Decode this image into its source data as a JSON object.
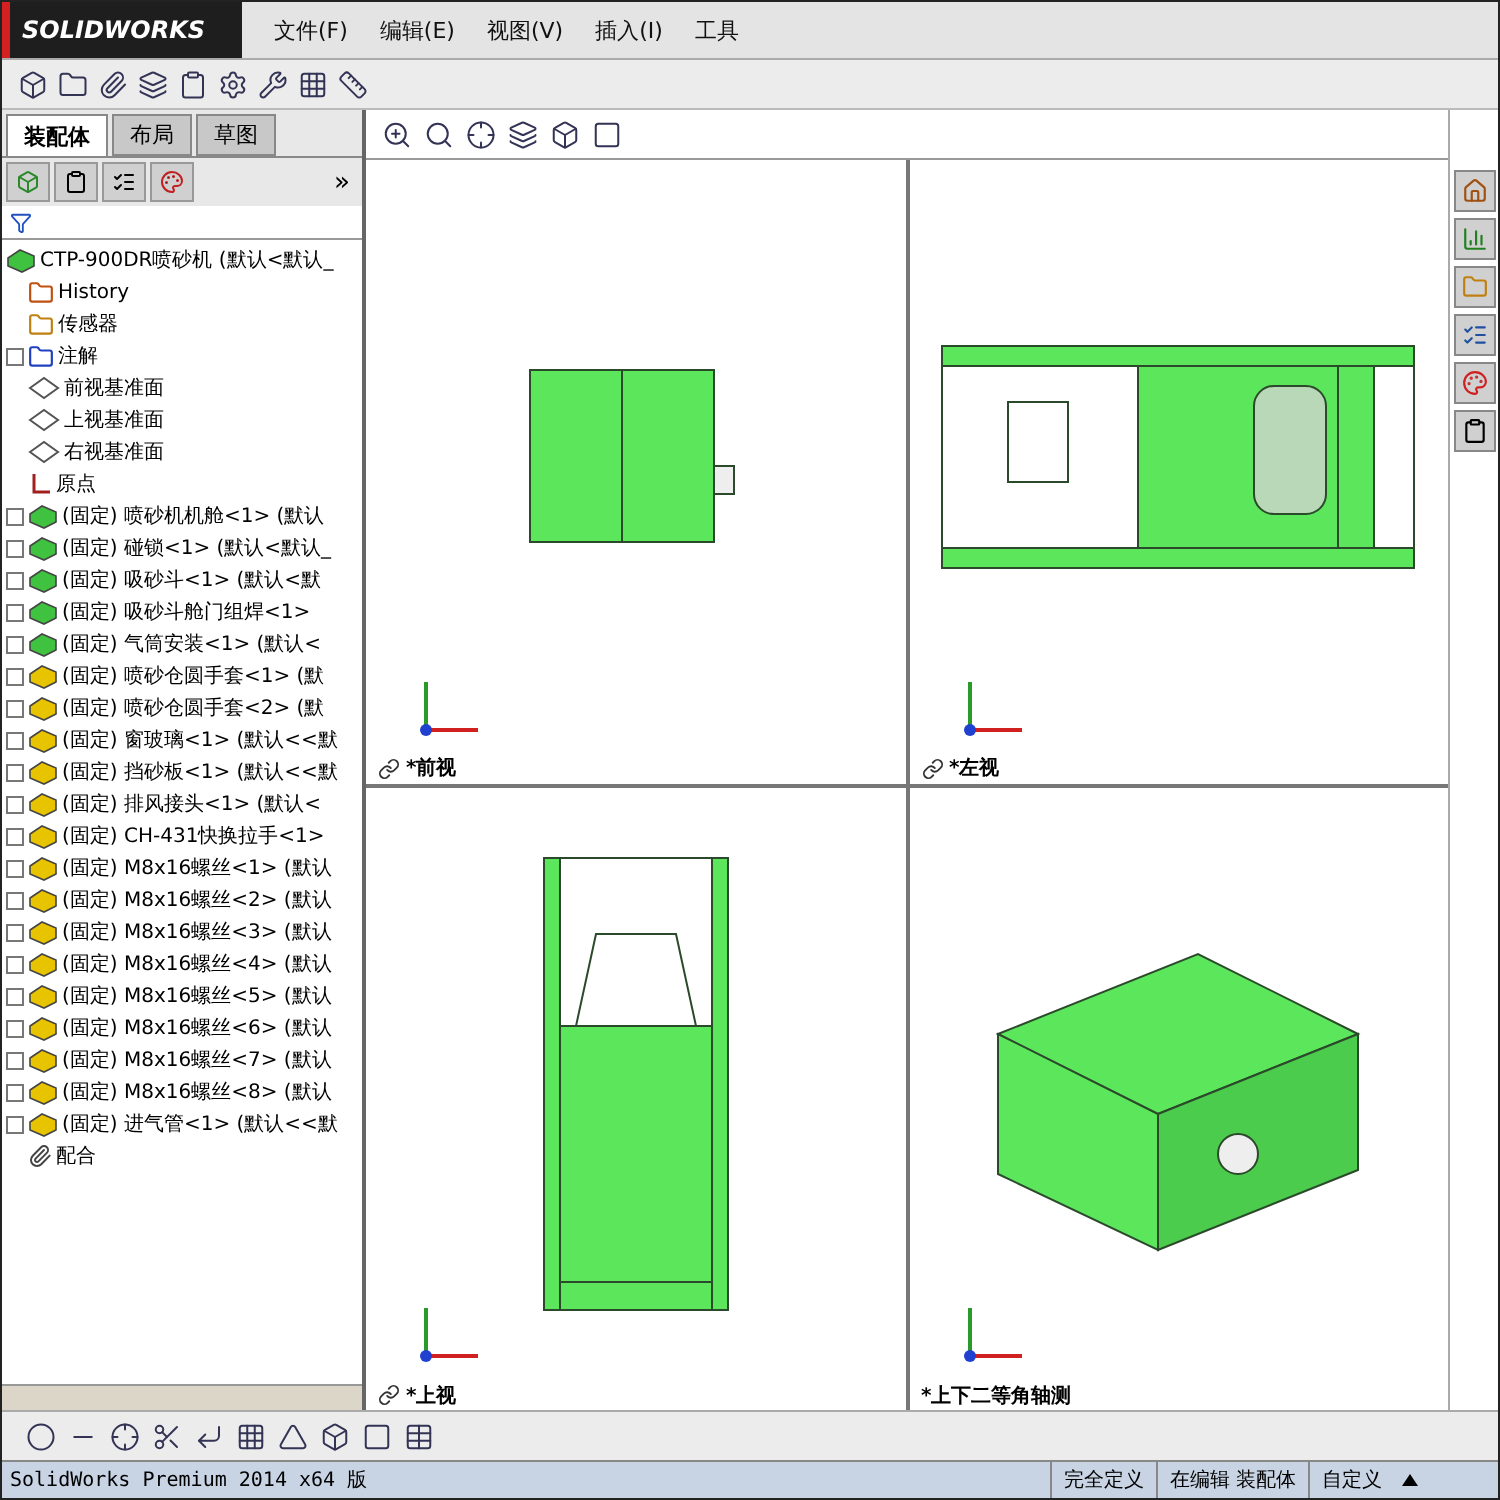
{
  "app": {
    "logo": "SOLIDWORKS",
    "menu": [
      "文件(F)",
      "编辑(E)",
      "视图(V)",
      "插入(I)",
      "工具"
    ]
  },
  "panel": {
    "tabs": [
      {
        "label": "装配体",
        "selected": true
      },
      {
        "label": "布局",
        "selected": false
      },
      {
        "label": "草图",
        "selected": false
      }
    ],
    "more": "»",
    "tree": {
      "label": "CTP-900DR喷砂机  (默认<默认_",
      "children": [
        {
          "kind": "history",
          "label": "History"
        },
        {
          "kind": "sensor",
          "label": "传感器"
        },
        {
          "kind": "annotation",
          "label": "注解",
          "expanded": false
        },
        {
          "kind": "plane",
          "label": "前视基准面"
        },
        {
          "kind": "plane",
          "label": "上视基准面"
        },
        {
          "kind": "plane",
          "label": "右视基准面"
        },
        {
          "kind": "origin",
          "label": "原点"
        },
        {
          "kind": "part",
          "label": "(固定) 喷砂机机舱<1> (默认",
          "expanded": false,
          "color": "#3fc23f"
        },
        {
          "kind": "part",
          "label": "(固定) 碰锁<1> (默认<默认_",
          "expanded": false,
          "color": "#3fc23f"
        },
        {
          "kind": "part",
          "label": "(固定) 吸砂斗<1> (默认<默",
          "expanded": false,
          "color": "#3fc23f"
        },
        {
          "kind": "part",
          "label": "(固定) 吸砂斗舱门组焊<1>",
          "expanded": false,
          "color": "#3fc23f"
        },
        {
          "kind": "part",
          "label": "(固定) 气筒安装<1> (默认<",
          "expanded": false,
          "color": "#3fc23f"
        },
        {
          "kind": "part",
          "label": "(固定) 喷砂仓圆手套<1> (默",
          "expanded": false,
          "color": "#e8c400"
        },
        {
          "kind": "part",
          "label": "(固定) 喷砂仓圆手套<2> (默",
          "expanded": false,
          "color": "#e8c400"
        },
        {
          "kind": "part",
          "label": "(固定) 窗玻璃<1> (默认<<默",
          "expanded": false,
          "color": "#e8c400"
        },
        {
          "kind": "part",
          "label": "(固定) 挡砂板<1> (默认<<默",
          "expanded": false,
          "color": "#e8c400"
        },
        {
          "kind": "part",
          "label": "(固定) 排风接头<1> (默认<",
          "expanded": false,
          "color": "#e8c400"
        },
        {
          "kind": "part",
          "label": "(固定) CH-431快换拉手<1>",
          "expanded": false,
          "color": "#e8c400"
        },
        {
          "kind": "part",
          "label": "(固定) M8x16螺丝<1> (默认",
          "expanded": false,
          "color": "#e8c400"
        },
        {
          "kind": "part",
          "label": "(固定) M8x16螺丝<2> (默认",
          "expanded": false,
          "color": "#e8c400"
        },
        {
          "kind": "part",
          "label": "(固定) M8x16螺丝<3> (默认",
          "expanded": false,
          "color": "#e8c400"
        },
        {
          "kind": "part",
          "label": "(固定) M8x16螺丝<4> (默认",
          "expanded": false,
          "color": "#e8c400"
        },
        {
          "kind": "part",
          "label": "(固定) M8x16螺丝<5> (默认",
          "expanded": false,
          "color": "#e8c400"
        },
        {
          "kind": "part",
          "label": "(固定) M8x16螺丝<6> (默认",
          "expanded": false,
          "color": "#e8c400"
        },
        {
          "kind": "part",
          "label": "(固定) M8x16螺丝<7> (默认",
          "expanded": false,
          "color": "#e8c400"
        },
        {
          "kind": "part",
          "label": "(固定) M8x16螺丝<8> (默认",
          "expanded": false,
          "color": "#e8c400"
        },
        {
          "kind": "part",
          "label": "(固定) 进气管<1> (默认<<默",
          "expanded": false,
          "color": "#e8c400"
        },
        {
          "kind": "mates",
          "label": "配合"
        }
      ]
    }
  },
  "viewports": [
    {
      "kind": "front",
      "label": "*前视"
    },
    {
      "kind": "left",
      "label": "*左视"
    },
    {
      "kind": "top",
      "label": "*上视"
    },
    {
      "kind": "iso",
      "label": "*上下二等角轴测"
    }
  ],
  "status_bar": {
    "product": "SolidWorks Premium 2014 x64 版",
    "segments": [
      "完全定义",
      "在编辑 装配体",
      "自定义"
    ]
  }
}
